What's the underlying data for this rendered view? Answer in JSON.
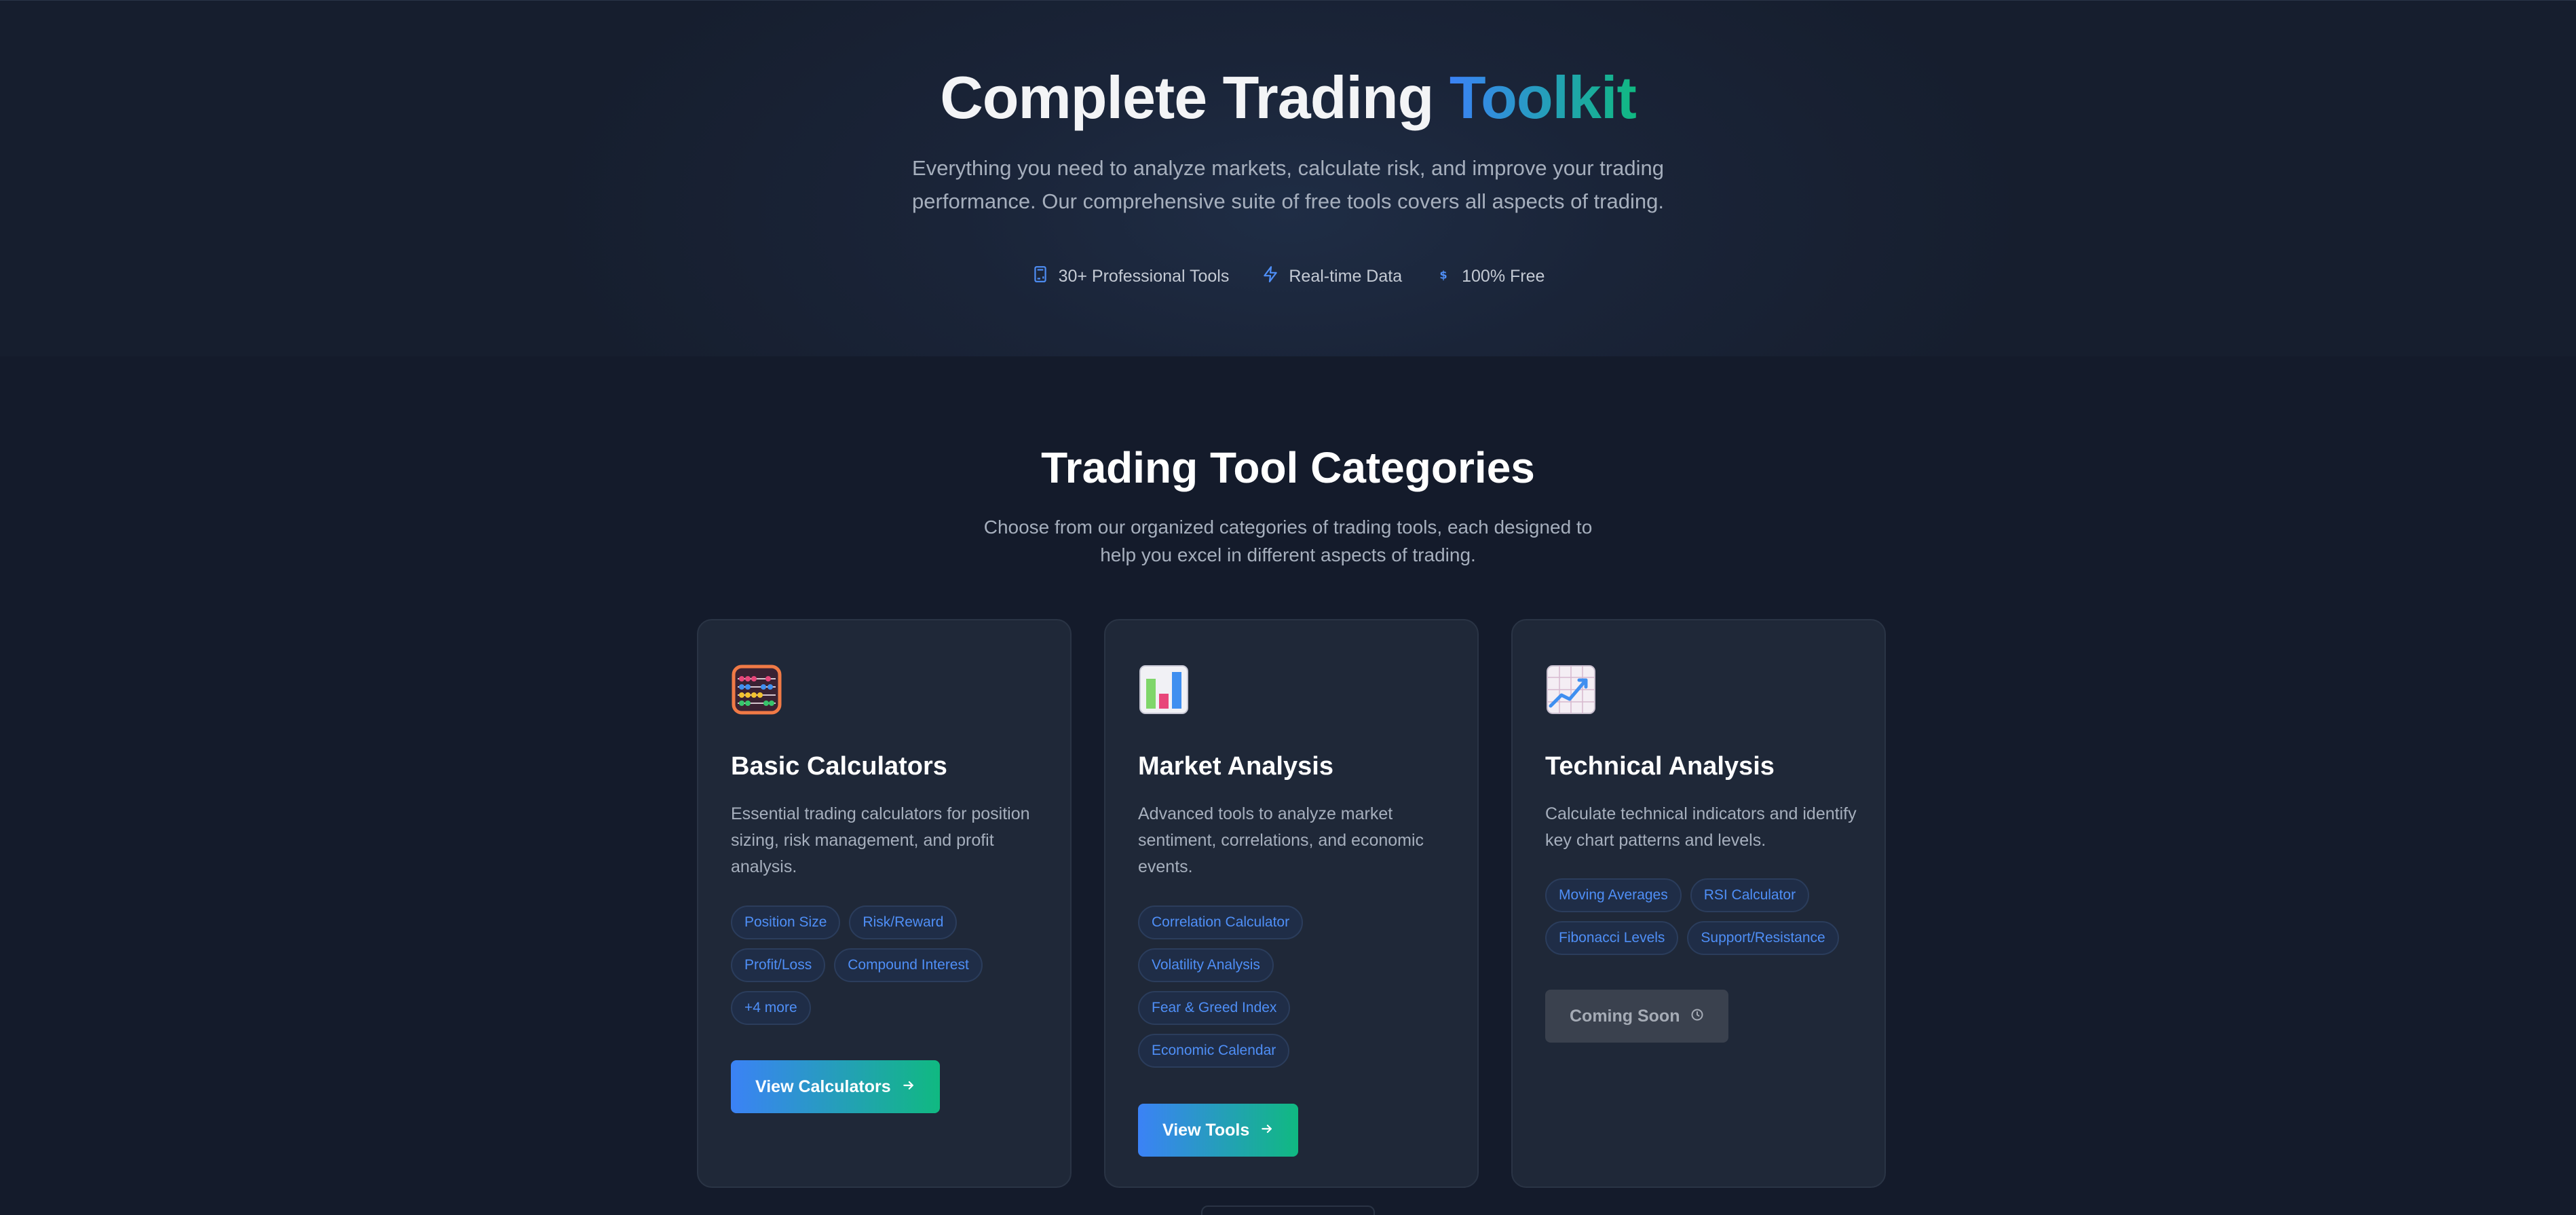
{
  "hero": {
    "title_main": "Complete Trading",
    "title_accent": "Toolkit",
    "subtitle": "Everything you need to analyze markets, calculate risk, and improve your trading performance. Our comprehensive suite of free tools covers all aspects of trading.",
    "features": [
      {
        "icon": "calculator-icon",
        "label": "30+ Professional Tools"
      },
      {
        "icon": "lightning-icon",
        "label": "Real-time Data"
      },
      {
        "icon": "dollar-icon",
        "label": "100% Free"
      }
    ]
  },
  "categories": {
    "title": "Trading Tool Categories",
    "subtitle": "Choose from our organized categories of trading tools, each designed to help you excel in different aspects of trading.",
    "cards": [
      {
        "icon": "abacus-icon",
        "title": "Basic Calculators",
        "description": "Essential trading calculators for position sizing, risk management, and profit analysis.",
        "tags": [
          "Position Size",
          "Risk/Reward",
          "Profit/Loss",
          "Compound Interest",
          "+4 more"
        ],
        "button": "View Calculators",
        "button_enabled": true
      },
      {
        "icon": "bar-chart-icon",
        "title": "Market Analysis",
        "description": "Advanced tools to analyze market sentiment, correlations, and economic events.",
        "tags": [
          "Correlation Calculator",
          "Volatility Analysis",
          "Fear & Greed Index",
          "Economic Calendar"
        ],
        "button": "View Tools",
        "button_enabled": true
      },
      {
        "icon": "line-chart-icon",
        "title": "Technical Analysis",
        "description": "Calculate technical indicators and identify key chart patterns and levels.",
        "tags": [
          "Moving Averages",
          "RSI Calculator",
          "Fibonacci Levels",
          "Support/Resistance"
        ],
        "button": "Coming Soon",
        "button_enabled": false
      }
    ]
  },
  "colors": {
    "background": "#141b2b",
    "card": "#1f2838",
    "accent_blue": "#3b82f6",
    "accent_green": "#10b981",
    "tag_text": "#4f8ff7"
  }
}
